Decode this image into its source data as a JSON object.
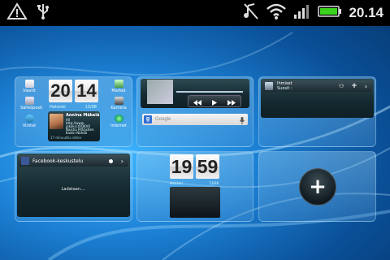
{
  "status_bar": {
    "time": "20.14",
    "icons": [
      "warning-icon",
      "usb-icon",
      "mute-icon",
      "wifi-icon",
      "signal-icon",
      "battery-icon"
    ]
  },
  "clock_widget": {
    "hour": "20",
    "minute": "14",
    "city": "Helsinki",
    "date": "13/08"
  },
  "apps_left": [
    {
      "label": "Viestit",
      "icon": "messages-icon"
    },
    {
      "label": "Sähköposti",
      "icon": "email-icon"
    },
    {
      "label": "Virstat",
      "icon": "footprints-icon"
    }
  ],
  "apps_right": [
    {
      "label": "Market",
      "icon": "market-icon"
    },
    {
      "label": "Kamera",
      "icon": "camera-icon"
    },
    {
      "label": "Internet",
      "icon": "internet-icon"
    }
  ],
  "contact_widget": {
    "name": "Annina Mäkelä",
    "line1": "All",
    "line2": "http://www.",
    "line3": "jakaksi.fi/QKV0",
    "line4": "Naistia Pitkästien",
    "line5": "Kaikki Nähdä",
    "footer": "17 minuuttia sitten"
  },
  "search_widget": {
    "placeholder": "Google"
  },
  "friendstream_widget": {
    "title": "Ihmiset",
    "subtitle": "Suosit :"
  },
  "facebook_widget": {
    "title": "Facebook-keskustelu",
    "status": "Ladataan...."
  },
  "small_clock_widget": {
    "hour": "19",
    "minute": "59",
    "city": "Helsinki",
    "date": "13/08"
  },
  "add_panel": {
    "symbol": "+"
  }
}
